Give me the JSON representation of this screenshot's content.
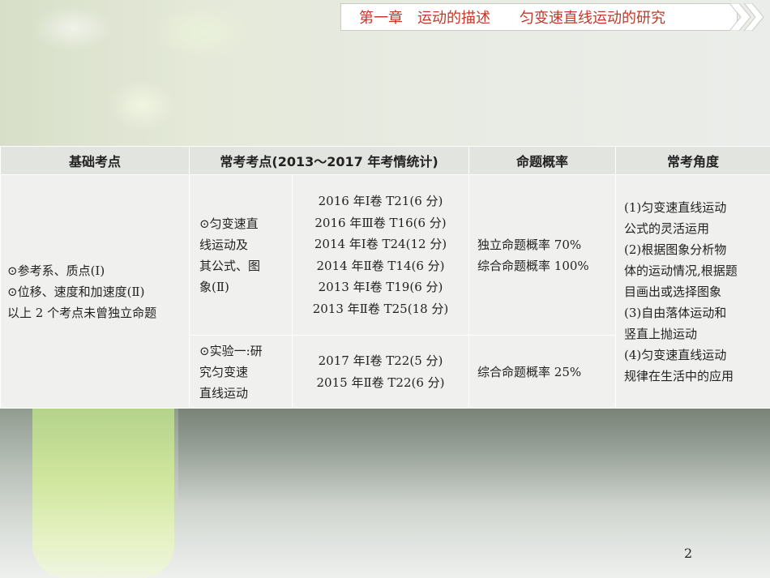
{
  "header": {
    "chapter": "第一章",
    "title1": "运动的描述",
    "title2": "匀变速直线运动的研究"
  },
  "table": {
    "headers": [
      "基础考点",
      "常考考点(2013～2017 年考情统计)",
      "命题概率",
      "常考角度"
    ],
    "basic": [
      "⊙参考系、质点(Ⅰ)",
      "⊙位移、速度和加速度(Ⅱ)",
      "以上 2 个考点未曾独立命题"
    ],
    "rows": [
      {
        "point": [
          "⊙匀变速直",
          "线运动及",
          "其公式、图",
          "象(Ⅱ)"
        ],
        "years": [
          "2016 年Ⅰ卷 T21(6 分)",
          "2016 年Ⅲ卷 T16(6 分)",
          "2014 年Ⅰ卷 T24(12 分)",
          "2014 年Ⅱ卷 T14(6 分)",
          "2013 年Ⅰ卷 T19(6 分)",
          "2013 年Ⅱ卷 T25(18 分)"
        ],
        "prob": [
          "独立命题概率 70%",
          "综合命题概率 100%"
        ]
      },
      {
        "point": [
          "⊙实验一:研",
          "究匀变速",
          "直线运动"
        ],
        "years": [
          "2017 年Ⅰ卷 T22(5 分)",
          "2015 年Ⅱ卷 T22(6 分)"
        ],
        "prob": [
          "综合命题概率 25%"
        ]
      }
    ],
    "angles": [
      "(1)匀变速直线运动",
      "公式的灵活运用",
      "(2)根据图象分析物",
      "体的运动情况,根据题",
      "目画出或选择图象",
      "(3)自由落体运动和",
      "竖直上抛运动",
      "(4)匀变速直线运动",
      "规律在生活中的应用"
    ]
  },
  "page_number": "2"
}
